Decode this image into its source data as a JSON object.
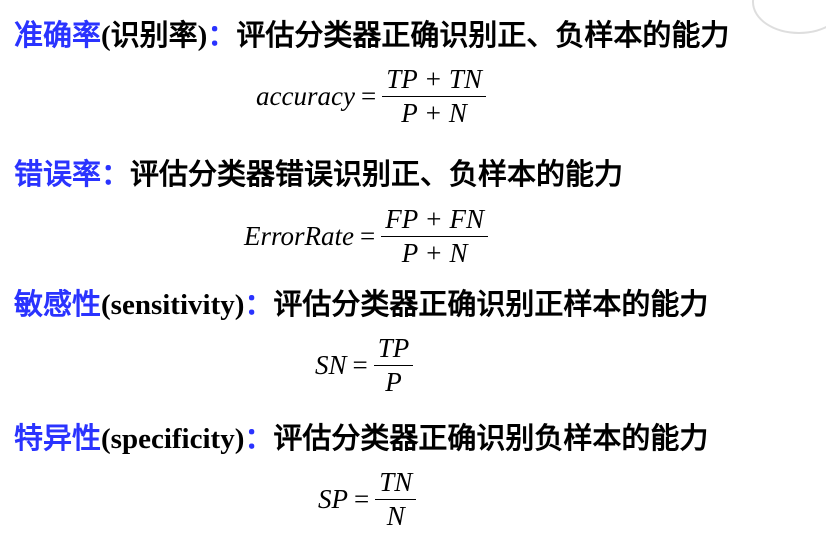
{
  "sections": [
    {
      "term": "准确率",
      "term_en": "(识别率)",
      "colon": "：",
      "desc": "评估分类器正确识别正、负样本的能力",
      "formula": {
        "lhs": "accuracy",
        "eq": "=",
        "num": "TP + TN",
        "den": "P + N"
      }
    },
    {
      "term": "错误率",
      "term_en": "",
      "colon": "：",
      "desc": "评估分类器错误识别正、负样本的能力",
      "formula": {
        "lhs": "ErrorRate",
        "eq": "=",
        "num": "FP + FN",
        "den": "P + N"
      }
    },
    {
      "term": "敏感性",
      "term_en": "(sensitivity)",
      "colon": "：",
      "desc": "评估分类器正确识别正样本的能力",
      "formula": {
        "lhs": "SN",
        "eq": "=",
        "num": "TP",
        "den": "P"
      }
    },
    {
      "term": "特异性",
      "term_en": "(specificity)",
      "colon": "：",
      "desc": "评估分类器正确识别负样本的能力",
      "formula": {
        "lhs": "SP",
        "eq": "=",
        "num": "TN",
        "den": "N"
      }
    }
  ],
  "colors": {
    "term": "#2a33ff",
    "text": "#000000"
  }
}
